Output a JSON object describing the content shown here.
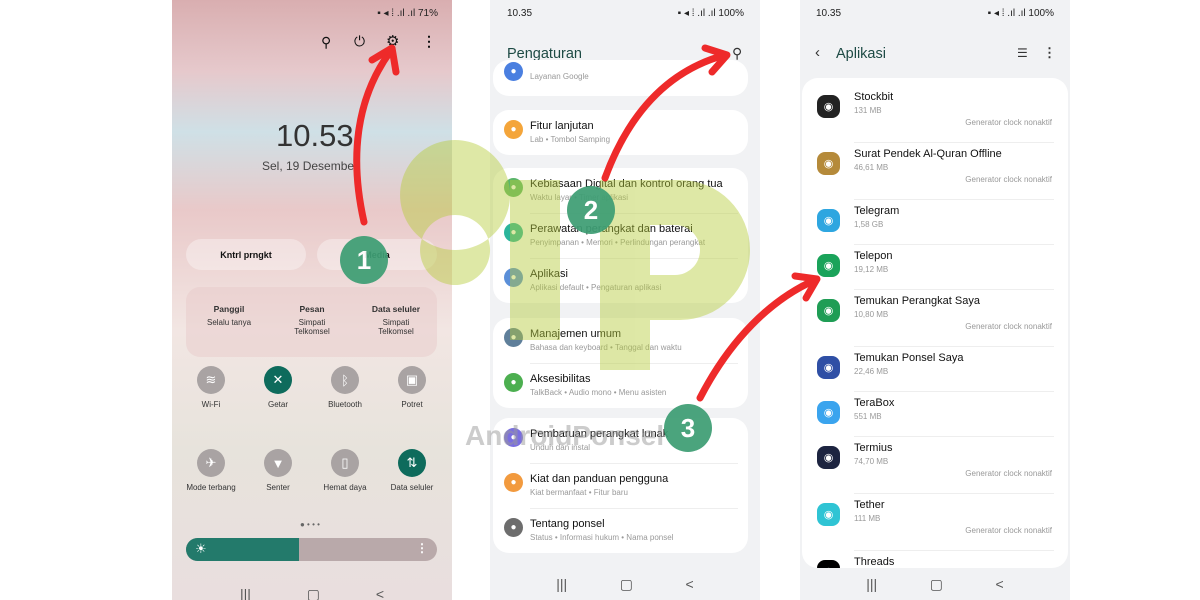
{
  "phone1": {
    "status": {
      "battery": "71%"
    },
    "top_icons": [
      "search-icon",
      "power-icon",
      "gear-icon",
      "more-icon"
    ],
    "clock": "10.53",
    "date": "Sel, 19 Desembe",
    "pills": [
      "Kntrl prngkt",
      "Media"
    ],
    "sim": [
      {
        "title": "Panggil",
        "line1": "Selalu tanya",
        "line2": ""
      },
      {
        "title": "Pesan",
        "line1": "Simpati",
        "line2": "Telkomsel"
      },
      {
        "title": "Data seluler",
        "line1": "Simpati",
        "line2": "Telkomsel"
      }
    ],
    "tiles": [
      {
        "label": "Wi-Fi",
        "icon": "wifi-icon",
        "on": false,
        "glyph": "≋"
      },
      {
        "label": "Getar",
        "icon": "vibrate-icon",
        "on": true,
        "glyph": "✕"
      },
      {
        "label": "Bluetooth",
        "icon": "bluetooth-icon",
        "on": false,
        "glyph": "ᛒ"
      },
      {
        "label": "Potret",
        "icon": "rotation-lock-icon",
        "on": false,
        "glyph": "▣"
      },
      {
        "label": "Mode terbang",
        "icon": "airplane-icon",
        "on": false,
        "glyph": "✈"
      },
      {
        "label": "Senter",
        "icon": "flashlight-icon",
        "on": false,
        "glyph": "▼"
      },
      {
        "label": "Hemat daya",
        "icon": "battery-saver-icon",
        "on": false,
        "glyph": "▯"
      },
      {
        "label": "Data seluler",
        "icon": "mobile-data-icon",
        "on": true,
        "glyph": "⇅"
      }
    ],
    "brightness": 0.45
  },
  "phone2": {
    "status": {
      "time": "10.35",
      "battery": "100%"
    },
    "title": "Pengaturan",
    "cards": [
      [
        {
          "name": "",
          "sub": "Layanan Google",
          "color": "#4a7fe0"
        }
      ],
      [
        {
          "name": "Fitur lanjutan",
          "sub": "Lab • Tombol Samping",
          "color": "#f4a53a"
        }
      ],
      [
        {
          "name": "Kebiasaan Digital dan kontrol orang tua",
          "sub": "Waktu layar • Timer aplikasi",
          "color": "#5bb56a"
        },
        {
          "name": "Perawatan perangkat dan baterai",
          "sub": "Penyimpanan • Memori • Perlindungan perangkat",
          "color": "#2bb59b"
        },
        {
          "name": "Aplikasi",
          "sub": "Aplikasi default • Pengaturan aplikasi",
          "color": "#5b8fd8"
        }
      ],
      [
        {
          "name": "Manajemen umum",
          "sub": "Bahasa dan keyboard • Tanggal dan waktu",
          "color": "#5f7f9a"
        },
        {
          "name": "Aksesibilitas",
          "sub": "TalkBack • Audio mono • Menu asisten",
          "color": "#4caf50"
        }
      ],
      [
        {
          "name": "Pembaruan perangkat lunak",
          "sub": "Unduh dan instal",
          "color": "#7a6ee0"
        },
        {
          "name": "Kiat dan panduan pengguna",
          "sub": "Kiat bermanfaat • Fitur baru",
          "color": "#f29a3e"
        },
        {
          "name": "Tentang ponsel",
          "sub": "Status • Informasi hukum • Nama ponsel",
          "color": "#6d6d6d"
        }
      ]
    ]
  },
  "phone3": {
    "status": {
      "time": "10.35",
      "battery": "100%"
    },
    "title": "Aplikasi",
    "apps": [
      {
        "name": "Stockbit",
        "size": "131 MB",
        "note": "Generator clock nonaktif",
        "color": "#222222"
      },
      {
        "name": "Surat Pendek Al-Quran Offline",
        "size": "46,61 MB",
        "note": "Generator clock nonaktif",
        "color": "#b58a3a"
      },
      {
        "name": "Telegram",
        "size": "1,58 GB",
        "note": "",
        "color": "#2ea6e0"
      },
      {
        "name": "Telepon",
        "size": "19,12 MB",
        "note": "",
        "color": "#1aa35a"
      },
      {
        "name": "Temukan Perangkat Saya",
        "size": "10,80 MB",
        "note": "Generator clock nonaktif",
        "color": "#1f9d55"
      },
      {
        "name": "Temukan Ponsel Saya",
        "size": "22,46 MB",
        "note": "",
        "color": "#2f4fa5"
      },
      {
        "name": "TeraBox",
        "size": "551 MB",
        "note": "",
        "color": "#3aa4ee"
      },
      {
        "name": "Termius",
        "size": "74,70 MB",
        "note": "Generator clock nonaktif",
        "color": "#1d2440"
      },
      {
        "name": "Tether",
        "size": "111 MB",
        "note": "Generator clock nonaktif",
        "color": "#2fc4d4"
      },
      {
        "name": "Threads",
        "size": "",
        "note": "",
        "color": "#000000"
      }
    ]
  },
  "steps": [
    "1",
    "2",
    "3"
  ],
  "watermark": {
    "logo": "dP",
    "text": "AndroidPonsel",
    "color": "#b5cc3a"
  },
  "nav": {
    "recent": "|||",
    "home": "▢",
    "back": "<"
  },
  "colors": {
    "arrow": "#ee2a2a",
    "badge": "#3e9e74",
    "accent": "#0e6b5c"
  }
}
